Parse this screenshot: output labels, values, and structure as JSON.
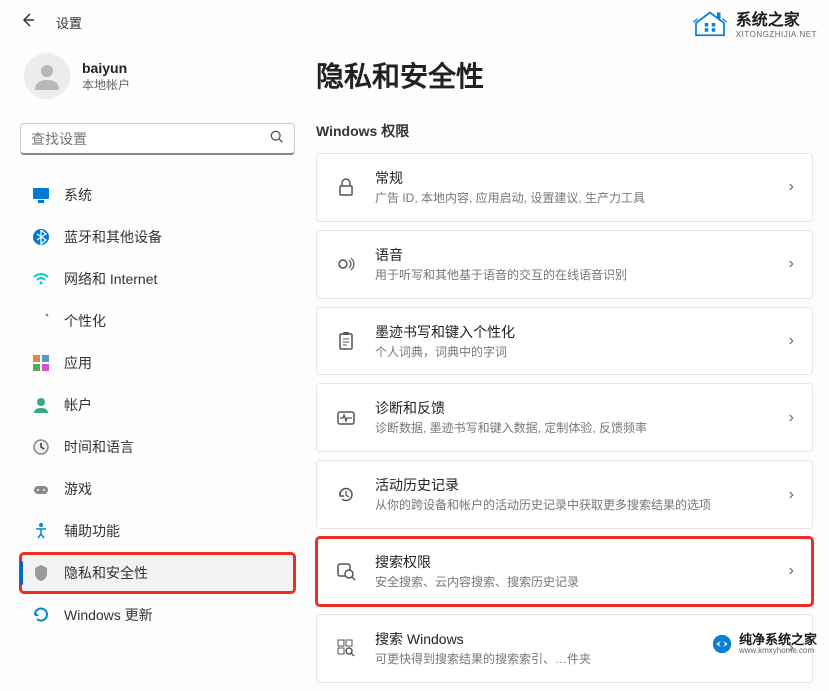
{
  "header": {
    "title": "设置"
  },
  "user": {
    "name": "baiyun",
    "account_type": "本地帐户"
  },
  "search": {
    "placeholder": "查找设置"
  },
  "sidebar": {
    "items": [
      {
        "label": "系统"
      },
      {
        "label": "蓝牙和其他设备"
      },
      {
        "label": "网络和 Internet"
      },
      {
        "label": "个性化"
      },
      {
        "label": "应用"
      },
      {
        "label": "帐户"
      },
      {
        "label": "时间和语言"
      },
      {
        "label": "游戏"
      },
      {
        "label": "辅助功能"
      },
      {
        "label": "隐私和安全性"
      },
      {
        "label": "Windows 更新"
      }
    ]
  },
  "main": {
    "title": "隐私和安全性",
    "section": "Windows 权限",
    "cards": [
      {
        "title": "常规",
        "sub": "广告 ID, 本地内容, 应用启动, 设置建议, 生产力工具"
      },
      {
        "title": "语音",
        "sub": "用于听写和其他基于语音的交互的在线语音识别"
      },
      {
        "title": "墨迹书写和键入个性化",
        "sub": "个人词典，词典中的字词"
      },
      {
        "title": "诊断和反馈",
        "sub": "诊断数据, 墨迹书写和键入数据, 定制体验, 反馈频率"
      },
      {
        "title": "活动历史记录",
        "sub": "从你的跨设备和帐户的活动历史记录中获取更多搜索结果的选项"
      },
      {
        "title": "搜索权限",
        "sub": "安全搜索、云内容搜索、搜索历史记录"
      },
      {
        "title": "搜索 Windows",
        "sub": "可更快得到搜索结果的搜索索引、…件夹"
      }
    ]
  },
  "logos": {
    "top": {
      "main": "系统之家",
      "sub": "XITONGZHIJIA.NET"
    },
    "bottom": {
      "main": "纯净系统之家",
      "sub": "www.kmxyhome.com"
    }
  }
}
